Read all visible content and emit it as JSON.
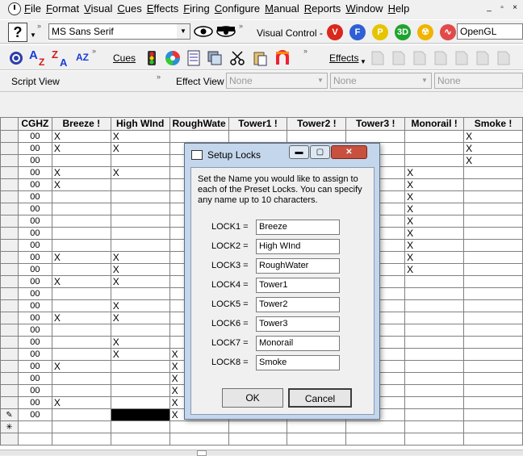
{
  "menubar": {
    "items": [
      "File",
      "Format",
      "Visual",
      "Cues",
      "Effects",
      "Firing",
      "Configure",
      "Manual",
      "Reports",
      "Window",
      "Help"
    ],
    "mdi_buttons": [
      "_",
      "▫",
      "×"
    ]
  },
  "toolbar1": {
    "font_combo": "MS Sans Serif",
    "visual_control_label": "Visual Control -",
    "circle_buttons": [
      {
        "label": "V",
        "color": "#d9281c"
      },
      {
        "label": "F",
        "color": "#2f5fd6"
      },
      {
        "label": "P",
        "color": "#e6c400"
      },
      {
        "label": "3D",
        "color": "#1fa32f"
      },
      {
        "label": "☢",
        "color": "#f0b400"
      },
      {
        "label": "∿",
        "color": "#e04a4a"
      }
    ],
    "renderer_combo": "OpenGL"
  },
  "toolbar2": {
    "cues_label": "Cues",
    "effects_label": "Effects"
  },
  "toolbar3": {
    "script_view_label": "Script View",
    "effect_view_label": "Effect View",
    "combos": [
      "None",
      "None",
      "None"
    ]
  },
  "grid": {
    "columns": [
      "CGHZ",
      "Breeze !",
      "High WInd",
      "RoughWate",
      "Tower1 !",
      "Tower2 !",
      "Tower3 !",
      "Monorail !",
      "Smoke !"
    ],
    "rows": [
      [
        "00",
        "X",
        "X",
        "",
        "",
        "",
        "",
        "",
        "X"
      ],
      [
        "00",
        "X",
        "X",
        "",
        "",
        "",
        "",
        "",
        "X"
      ],
      [
        "00",
        "",
        "",
        "",
        "",
        "",
        "",
        "",
        "X"
      ],
      [
        "00",
        "X",
        "X",
        "",
        "",
        "",
        "",
        "X",
        ""
      ],
      [
        "00",
        "X",
        "",
        "",
        "",
        "",
        "",
        "X",
        ""
      ],
      [
        "00",
        "",
        "",
        "",
        "",
        "",
        "",
        "X",
        ""
      ],
      [
        "00",
        "",
        "",
        "",
        "",
        "",
        "",
        "X",
        ""
      ],
      [
        "00",
        "",
        "",
        "",
        "",
        "",
        "",
        "X",
        ""
      ],
      [
        "00",
        "",
        "",
        "",
        "",
        "",
        "",
        "X",
        ""
      ],
      [
        "00",
        "",
        "",
        "",
        "",
        "",
        "",
        "X",
        ""
      ],
      [
        "00",
        "X",
        "X",
        "",
        "",
        "",
        "",
        "X",
        ""
      ],
      [
        "00",
        "",
        "X",
        "",
        "",
        "",
        "",
        "X",
        ""
      ],
      [
        "00",
        "X",
        "X",
        "",
        "",
        "",
        "",
        "",
        ""
      ],
      [
        "00",
        "",
        "",
        "",
        "",
        "",
        "",
        "",
        ""
      ],
      [
        "00",
        "",
        "X",
        "",
        "",
        "",
        "",
        "",
        ""
      ],
      [
        "00",
        "X",
        "X",
        "",
        "",
        "",
        "",
        "",
        ""
      ],
      [
        "00",
        "",
        "",
        "",
        "",
        "",
        "",
        "",
        ""
      ],
      [
        "00",
        "",
        "X",
        "",
        "",
        "",
        "",
        "",
        ""
      ],
      [
        "00",
        "",
        "X",
        "X",
        "",
        "",
        "",
        "",
        ""
      ],
      [
        "00",
        "X",
        "",
        "X",
        "",
        "",
        "",
        "",
        ""
      ],
      [
        "00",
        "",
        "",
        "X",
        "",
        "",
        "",
        "",
        ""
      ],
      [
        "00",
        "",
        "",
        "X",
        "",
        "",
        "",
        "",
        ""
      ],
      [
        "00",
        "X",
        "",
        "X",
        "",
        "",
        "",
        "",
        ""
      ],
      [
        "00",
        "",
        "",
        "X",
        "",
        "",
        "",
        "",
        ""
      ]
    ],
    "edit_row_marker": "✎",
    "new_row_marker": "✳"
  },
  "dialog": {
    "title": "Setup Locks",
    "description": "Set the Name you would like to assign to each of the Preset Locks.  You can specify any name up to 10 characters.",
    "locks": [
      {
        "label": "LOCK1 =",
        "value": "Breeze"
      },
      {
        "label": "LOCK2 =",
        "value": "High WInd"
      },
      {
        "label": "LOCK3 =",
        "value": "RoughWater"
      },
      {
        "label": "LOCK4 =",
        "value": "Tower1"
      },
      {
        "label": "LOCK5 =",
        "value": "Tower2"
      },
      {
        "label": "LOCK6 =",
        "value": "Tower3"
      },
      {
        "label": "LOCK7 =",
        "value": "Monorail"
      },
      {
        "label": "LOCK8 =",
        "value": "Smoke"
      }
    ],
    "ok_label": "OK",
    "cancel_label": "Cancel"
  }
}
